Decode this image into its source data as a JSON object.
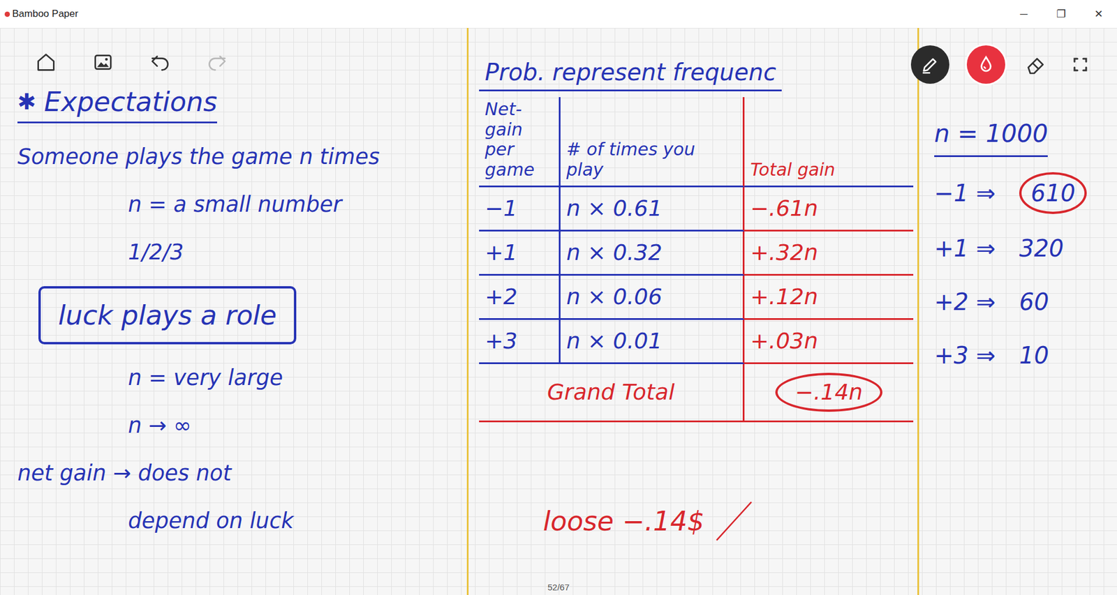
{
  "window": {
    "title": "Bamboo Paper",
    "controls": [
      "─",
      "❐",
      "✕"
    ]
  },
  "toolbar": {
    "left": [
      {
        "kind": "home",
        "disabled": false
      },
      {
        "kind": "image",
        "disabled": false
      },
      {
        "kind": "undo",
        "disabled": false
      },
      {
        "kind": "redo",
        "disabled": true
      }
    ],
    "right": [
      {
        "kind": "pen",
        "selected": true
      },
      {
        "kind": "ink",
        "selected": true,
        "color": "#e8323f"
      },
      {
        "kind": "eraser",
        "selected": false
      },
      {
        "kind": "crop",
        "selected": false
      }
    ]
  },
  "left_notes": {
    "mark": "✱",
    "title": "Expectations",
    "lines": [
      {
        "text": "Someone plays the game n times",
        "kind": "plain"
      },
      {
        "text": "n = a small number",
        "kind": "indent"
      },
      {
        "text": "1/2/3",
        "kind": "indent"
      },
      {
        "text": "luck plays a role",
        "kind": "boxed"
      },
      {
        "text": "n = very large",
        "kind": "indent"
      },
      {
        "text": "n → ∞",
        "kind": "indent"
      },
      {
        "text": "net gain → does not",
        "kind": "plain"
      },
      {
        "text": "depend on luck",
        "kind": "indent"
      }
    ]
  },
  "table": {
    "heading": "Prob. represent frequenc",
    "columns": [
      "Net-gain per game",
      "# of times you play",
      "Total gain"
    ],
    "rows": [
      [
        "−1",
        "n × 0.61",
        "−.61n"
      ],
      [
        "+1",
        "n × 0.32",
        "+.32n"
      ],
      [
        "+2",
        "n × 0.06",
        "+.12n"
      ],
      [
        "+3",
        "n × 0.01",
        "+.03n"
      ]
    ],
    "total": {
      "label": "Grand Total",
      "value": "−.14n"
    }
  },
  "note": "loose −.14$",
  "side": {
    "title": "n = 1000",
    "rows": [
      {
        "key": "−1 ⇒",
        "value": "610",
        "circled": true
      },
      {
        "key": "+1 ⇒",
        "value": "320",
        "circled": false
      },
      {
        "key": "+2 ⇒",
        "value": "60",
        "circled": false
      },
      {
        "key": "+3 ⇒",
        "value": "10",
        "circled": false
      }
    ]
  },
  "page": {
    "number": "52/67"
  }
}
